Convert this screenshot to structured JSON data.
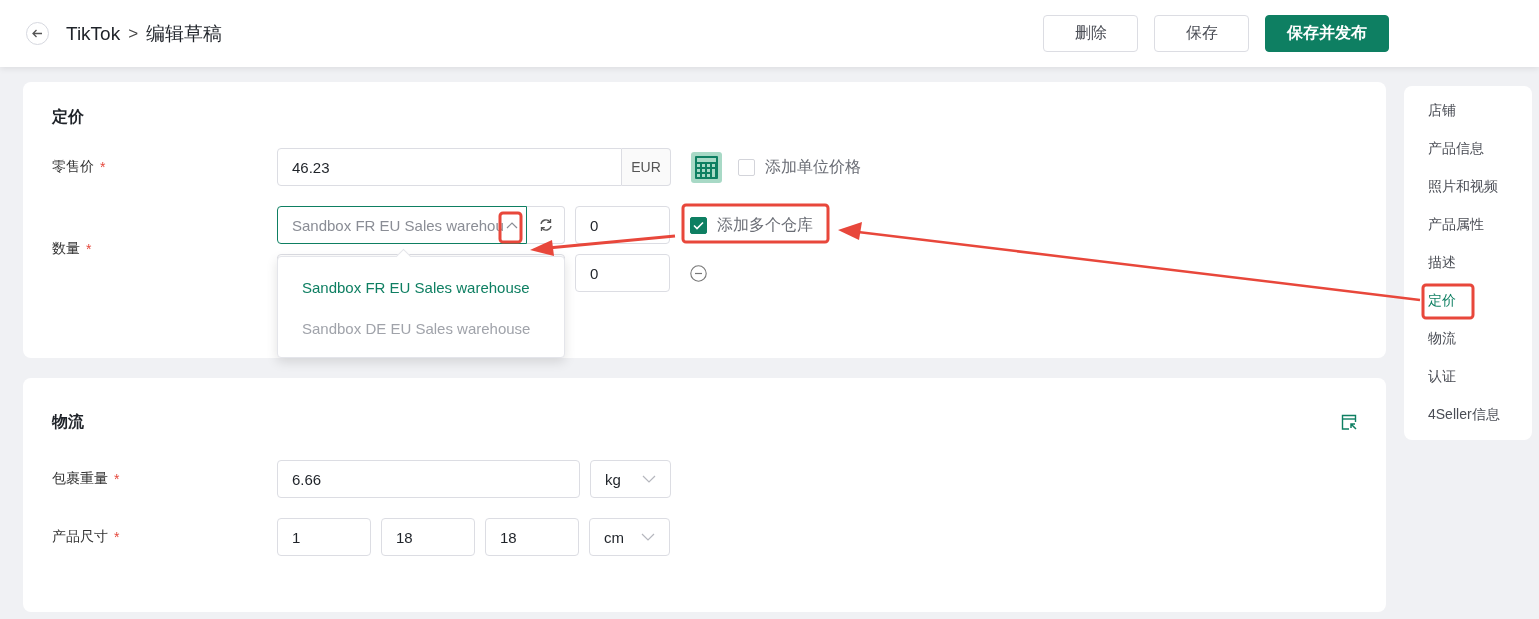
{
  "header": {
    "breadcrumb": [
      "TikTok",
      "编辑草稿"
    ],
    "separator": ">",
    "buttons": [
      {
        "label": "删除",
        "kind": "outline"
      },
      {
        "label": "保存",
        "kind": "outline"
      },
      {
        "label": "保存并发布",
        "kind": "primary"
      }
    ]
  },
  "pricing": {
    "title": "定价",
    "retail_price": {
      "label": "零售价",
      "asterisk": "*",
      "value": "46.23",
      "currency": "EUR"
    },
    "unit_price": {
      "label": "添加单位价格",
      "checked": false
    },
    "quantity": {
      "label": "数量",
      "asterisk": "*",
      "warehouses": [
        {
          "kind": "main",
          "placeholder": "Sandbox FR EU Sales warehou",
          "focused": true,
          "value": "0"
        },
        {
          "kind": "added",
          "focused": false,
          "value": "0"
        }
      ],
      "multi_warehouse": {
        "label": "添加多个仓库",
        "checked": true
      },
      "dropdown": [
        {
          "label": "Sandbox FR EU Sales warehouse",
          "selected": true
        },
        {
          "label": "Sandbox DE EU Sales warehouse",
          "selected": false
        }
      ]
    }
  },
  "logistics": {
    "title": "物流",
    "weight": {
      "label": "包裹重量",
      "asterisk": "*",
      "value": "6.66",
      "unit": "kg"
    },
    "dimensions": {
      "label": "产品尺寸",
      "asterisk": "*",
      "values": [
        "1",
        "18",
        "18"
      ],
      "unit": "cm"
    }
  },
  "nav": [
    {
      "label": "店铺",
      "selected": false
    },
    {
      "label": "产品信息",
      "selected": false
    },
    {
      "label": "照片和视频",
      "selected": false
    },
    {
      "label": "产品属性",
      "selected": false
    },
    {
      "label": "描述",
      "selected": false
    },
    {
      "label": "定价",
      "selected": true
    },
    {
      "label": "物流",
      "selected": false
    },
    {
      "label": "认证",
      "selected": false
    },
    {
      "label": "4Seller信息",
      "selected": false
    }
  ]
}
